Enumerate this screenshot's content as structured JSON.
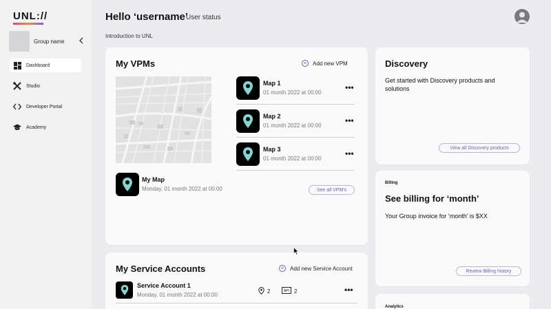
{
  "sidebar": {
    "logo": "UNL://",
    "group_name": "Group name",
    "items": [
      {
        "label": "Dashboard",
        "icon": "dashboard-icon",
        "active": true
      },
      {
        "label": "Studio",
        "icon": "studio-tools-icon",
        "active": false
      },
      {
        "label": "Developer Portal",
        "icon": "code-icon",
        "active": false
      },
      {
        "label": "Academy",
        "icon": "graduation-cap-icon",
        "active": false
      }
    ]
  },
  "header": {
    "greeting": "Hello ‘username’",
    "status": "User status",
    "intro": "Introduction to UNL"
  },
  "vpms": {
    "title": "My VPMs",
    "add_label": "Add new VPM",
    "maps": [
      {
        "name": "Map 1",
        "date": "01 month 2022 at 00:00"
      },
      {
        "name": "Map 2",
        "date": "01 month 2022 at 00:00"
      },
      {
        "name": "Map 3",
        "date": "01 month 2022 at 00:00"
      }
    ],
    "featured": {
      "name": "My Map",
      "date": "Monday, 01 month 2022 at 00:00"
    },
    "see_all": "See all VPM's",
    "more_symbol": "•••"
  },
  "discovery": {
    "title": "Discovery",
    "text": "Get started with Discovery products and solutions",
    "button": "View all Discovery products"
  },
  "billing": {
    "label": "Billing",
    "title": "See billing for ‘month’",
    "text": "Your Group invoice for ‘month’ is $XX",
    "button": "Review Billing history"
  },
  "analytics": {
    "label": "Analytics"
  },
  "service_accounts": {
    "title": "My Service Accounts",
    "add_label": "Add new Service Account",
    "items": [
      {
        "name": "Service Account 1",
        "date": "Monday, 01 month 2022 at 00:00",
        "locations": "2",
        "apis": "2"
      }
    ],
    "more_symbol": "•••"
  },
  "colors": {
    "accent": "#6a5bd6",
    "pin": "#7fd9d2",
    "tile": "#000000"
  }
}
